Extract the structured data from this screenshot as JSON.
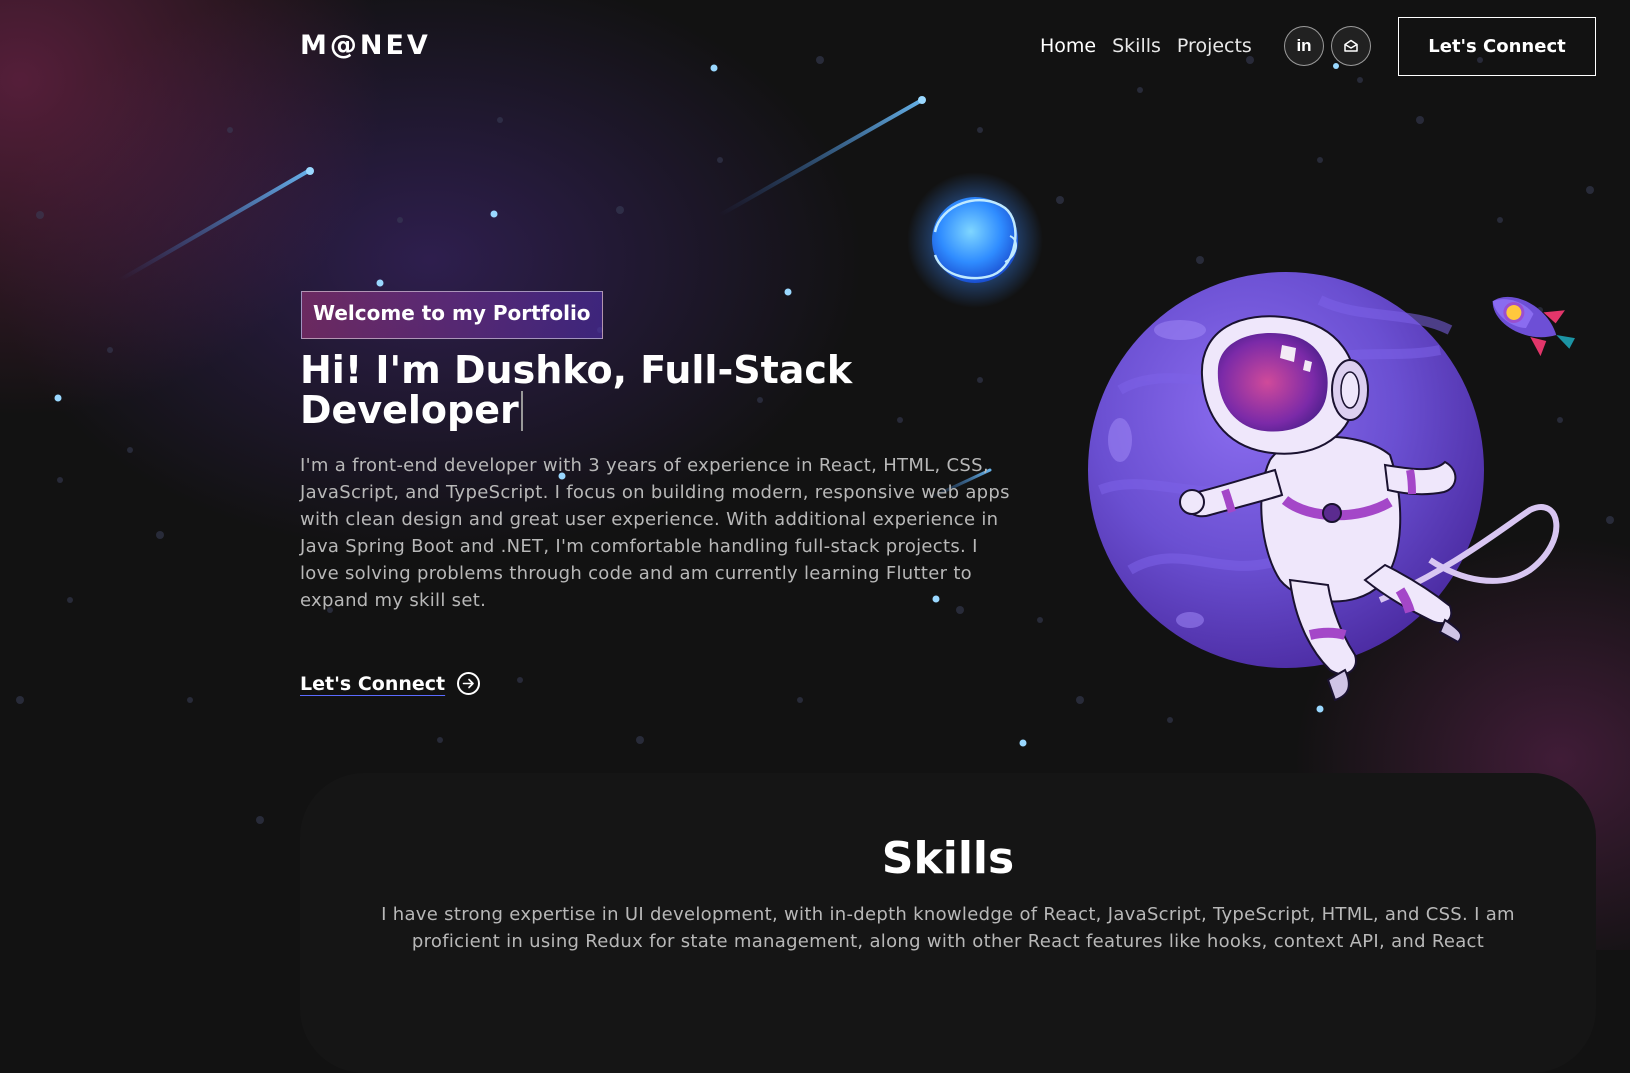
{
  "brand": {
    "logo": "M@NEV"
  },
  "nav": {
    "links": [
      "Home",
      "Skills",
      "Projects"
    ],
    "social": [
      {
        "icon": "linkedin-icon",
        "glyph": "in"
      },
      {
        "icon": "mail-icon"
      }
    ],
    "cta_label": "Let's Connect"
  },
  "hero": {
    "tagline": "Welcome to my Portfolio",
    "title": "Hi! I'm Dushko, Full-Stack Developer",
    "description": "I'm a front-end developer with 3 years of experience in React, HTML, CSS, JavaScript, and TypeScript. I focus on building modern, responsive web apps with clean design and great user experience. With additional experience in Java Spring Boot and .NET, I'm comfortable handling full-stack projects. I love solving problems through code and am currently learning Flutter to expand my skill set.",
    "cta_label": "Let's Connect",
    "cta_icon": "arrow-right-circle-icon"
  },
  "skills": {
    "title": "Skills",
    "description": "I have strong expertise in UI development, with in-depth knowledge of React, JavaScript, TypeScript, HTML, and CSS. I am proficient in using Redux for state management, along with other React features like hooks, context API, and React"
  },
  "colors": {
    "background": "#121212",
    "accent_pink": "#AA367C",
    "accent_purple": "#4A2FBD",
    "planet_purple": "#6a4fd1",
    "link_underline": "#5b6bff"
  }
}
